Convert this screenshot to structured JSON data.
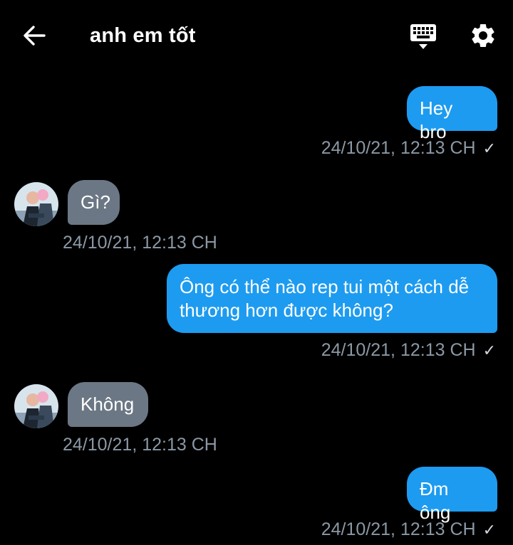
{
  "header": {
    "title": "anh em tốt",
    "back_icon": "arrow-left-icon",
    "keyboard_icon": "keyboard-icon",
    "settings_icon": "gear-icon"
  },
  "colors": {
    "background": "#000000",
    "outgoing_bubble": "#1d9bf0",
    "incoming_bubble": "#6b7784",
    "timestamp": "#8b98a5"
  },
  "messages": [
    {
      "direction": "out",
      "text": "Hey bro",
      "time": "24/10/21, 12:13 CH",
      "status": "✓"
    },
    {
      "direction": "in",
      "text": "Gì?",
      "time": "24/10/21, 12:13 CH"
    },
    {
      "direction": "out",
      "line1": "Ông có thể nào rep tui một cách dễ",
      "line2": "thương hơn được không?",
      "time": "24/10/21, 12:13 CH",
      "status": "✓"
    },
    {
      "direction": "in",
      "text": "Không",
      "time": "24/10/21, 12:13 CH"
    },
    {
      "direction": "out",
      "text": "Đm ông",
      "time": "24/10/21, 12:13 CH",
      "status": "✓"
    }
  ]
}
